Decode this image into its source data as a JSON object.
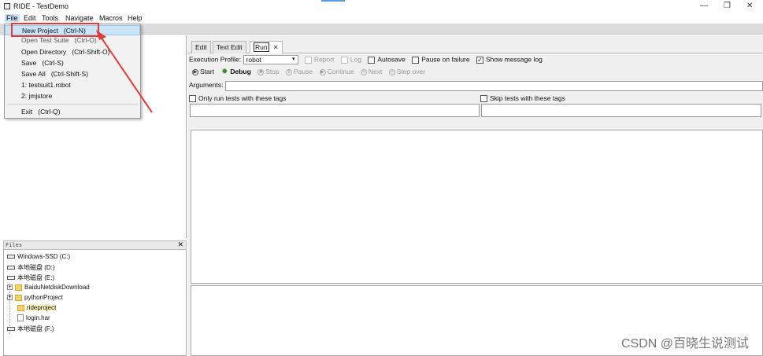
{
  "window": {
    "title": "RIDE - TestDemo",
    "minimize_glyph": "—",
    "maximize_glyph": "❐",
    "close_glyph": "✕"
  },
  "menubar": [
    "File",
    "Edit",
    "Tools",
    "Navigate",
    "Macros",
    "Help"
  ],
  "file_menu": {
    "items": [
      {
        "label": "New Project",
        "shortcut": "(Ctrl-N)"
      },
      {
        "label": "Open Test Suite",
        "shortcut": "(Ctrl-O)"
      },
      {
        "label": "Open Directory",
        "shortcut": "(Ctrl-Shift-O)"
      },
      {
        "label": "Save",
        "shortcut": "(Ctrl-S)"
      },
      {
        "label": "Save All",
        "shortcut": "(Ctrl-Shift-S)"
      },
      {
        "label": "1: testsuit1.robot",
        "shortcut": ""
      },
      {
        "label": "2: jmjstore",
        "shortcut": ""
      },
      {
        "label": "Exit",
        "shortcut": "(Ctrl-Q)"
      }
    ]
  },
  "files_panel": {
    "title": "Files",
    "close_glyph": "✕",
    "items": [
      {
        "label": "Windows-SSD (C:)"
      },
      {
        "label": "本地磁盘 (D:)"
      },
      {
        "label": "本地磁盘 (E:)"
      },
      {
        "label": "BaiduNetdiskDownload"
      },
      {
        "label": "pythonProject"
      },
      {
        "label": "rideproject"
      },
      {
        "label": "login.har"
      },
      {
        "label": "本地磁盘 (F:)"
      }
    ]
  },
  "editor": {
    "tabs": [
      {
        "label": "Edit"
      },
      {
        "label": "Text Edit"
      },
      {
        "label": "Run",
        "close_glyph": "✕"
      }
    ],
    "execution_profile_label": "Execution Profile:",
    "execution_profile_value": "robot",
    "report_label": "Report",
    "log_label": "Log",
    "autosave_label": "Autosave",
    "pause_on_failure_label": "Pause on failure",
    "show_message_log_label": "Show message log",
    "show_message_log_checked": true,
    "run_buttons": {
      "start": "Start",
      "debug": "Debug",
      "stop": "Stop",
      "pause": "Pause",
      "continue": "Continue",
      "next": "Next",
      "step_over": "Step over"
    },
    "arguments_label": "Arguments:",
    "arguments_value": "",
    "only_run_tags_label": "Only run tests with these tags",
    "skip_tags_label": "Skip tests with these tags"
  },
  "watermark": "CSDN @百晓生说测试",
  "colors": {
    "highlight": "#cce4f7",
    "annotation_red": "#e23939"
  }
}
